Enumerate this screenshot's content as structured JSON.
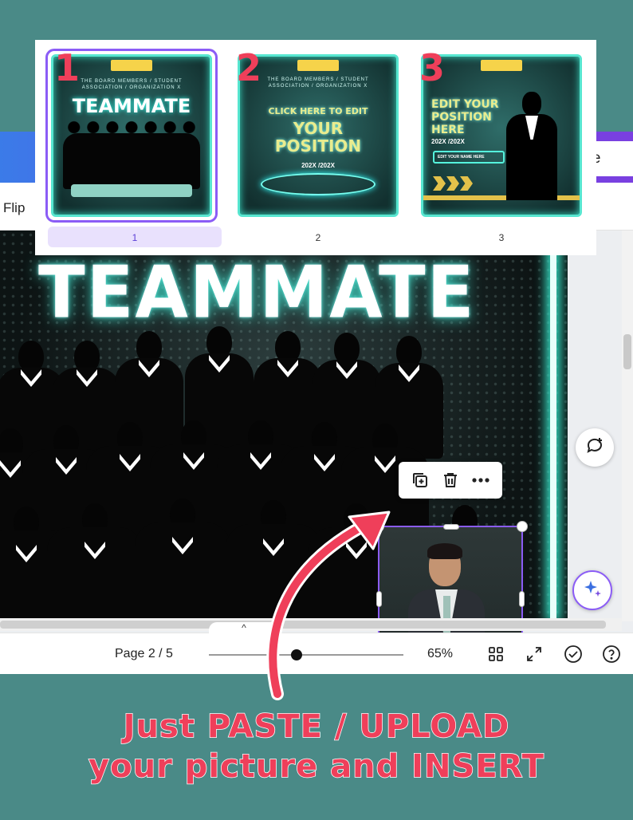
{
  "editor": {
    "share_label": "are",
    "flip_label": "Flip",
    "design_title": "TEAMMATE",
    "page_indicator": "Page 2 / 5",
    "zoom_percent": "65%",
    "zoom_level": 0.45,
    "pager_chevron": "^"
  },
  "pages": [
    {
      "big_number": "1",
      "number_label": "1",
      "subtitle": "THE BOARD MEMBERS / STUDENT ASSOCIATION / ORGANIZATION X",
      "title": "TEAMMATE",
      "selected": true
    },
    {
      "big_number": "2",
      "number_label": "2",
      "subtitle": "THE BOARD MEMBERS / STUDENT ASSOCIATION / ORGANIZATION X",
      "cta": "CLICK HERE TO EDIT",
      "title_line1": "YOUR",
      "title_line2": "POSITION",
      "years": "202X /202X",
      "selected": false
    },
    {
      "big_number": "3",
      "number_label": "3",
      "title_line1": "EDIT YOUR",
      "title_line2": "POSITION",
      "title_line3": "HERE",
      "years": "202X /202X",
      "name_field": "EDIT YOUR NAME HERE",
      "selected": false
    }
  ],
  "annotation": {
    "line1": "Just PASTE / UPLOAD",
    "line2": "your picture and INSERT",
    "color": "#ef3f5a"
  },
  "colors": {
    "background": "#4a8a87",
    "accent": "#8b5cf6",
    "neon": "#36e3c8"
  },
  "icons": [
    "duplicate-icon",
    "trash-icon",
    "more-icon",
    "comment-add-icon",
    "magic-sparkle-icon",
    "grid-view-icon",
    "fullscreen-icon",
    "check-circle-icon",
    "help-icon",
    "rotate-icon"
  ]
}
